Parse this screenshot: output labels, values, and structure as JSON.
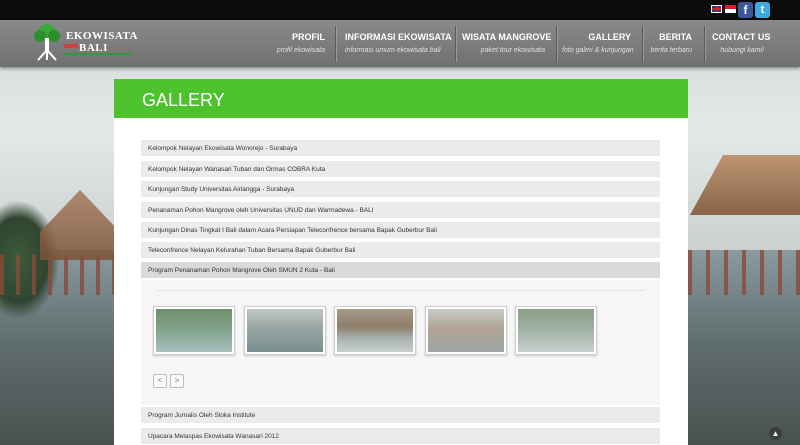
{
  "topbar": {
    "languages": [
      {
        "name": "uk-flag-icon"
      },
      {
        "name": "indonesia-flag-icon"
      }
    ],
    "social": [
      {
        "name": "facebook-icon",
        "glyph": "f",
        "color": "#3b5998"
      },
      {
        "name": "twitter-icon",
        "glyph": "t",
        "color": "#3fa9e0"
      }
    ]
  },
  "logo": {
    "line1": "EKOWISATA",
    "line2": "BALI"
  },
  "nav": [
    {
      "label": "PROFIL",
      "sub": "profil ekowisata"
    },
    {
      "label": "INFORMASI EKOWISATA",
      "sub": "informasi umum ekowisata bali"
    },
    {
      "label": "WISATA MANGROVE",
      "sub": "paket tour ekowisata"
    },
    {
      "label": "GALLERY",
      "sub": "foto galeri & kunjungan"
    },
    {
      "label": "BERITA",
      "sub": "berita terbaru"
    },
    {
      "label": "CONTACT US",
      "sub": "hubungi kami!"
    }
  ],
  "page": {
    "title": "GALLERY"
  },
  "gallery": {
    "items": [
      "Kelompok Nelayan Ekowisata Wonorejo - Surabaya",
      "Kelompok Nelayan Wanasari Tuban dan Ormas COBRA Kuta",
      "Kunjungan Study Universitas Airlangga - Surabaya",
      "Penanaman Pohon Mangrove oleh Universitas UNUD dan Warmadewa - BALI",
      "Kunjungan Dinas Tingkat I Bali dalam Acara Persiapan Teleconfrence bersama Bapak Guberbur Bali",
      "Teleconfrence Nelayan Kelurahan Tuban Bersama Bapak Guberbur Bali",
      "Program Penanaman Pohon Mangrove Oleh SMUN 2 Kuta - Bali"
    ],
    "after_items": [
      "Program Jurnalis Oleh Sloka Institute",
      "Upacara Melaspas Ekowisata Wanasari 2012"
    ],
    "prev_label": "<",
    "next_label": ">"
  },
  "scroll_top_label": "▲",
  "colors": {
    "accent": "#4ec22c",
    "header": "#7a7a7a"
  }
}
